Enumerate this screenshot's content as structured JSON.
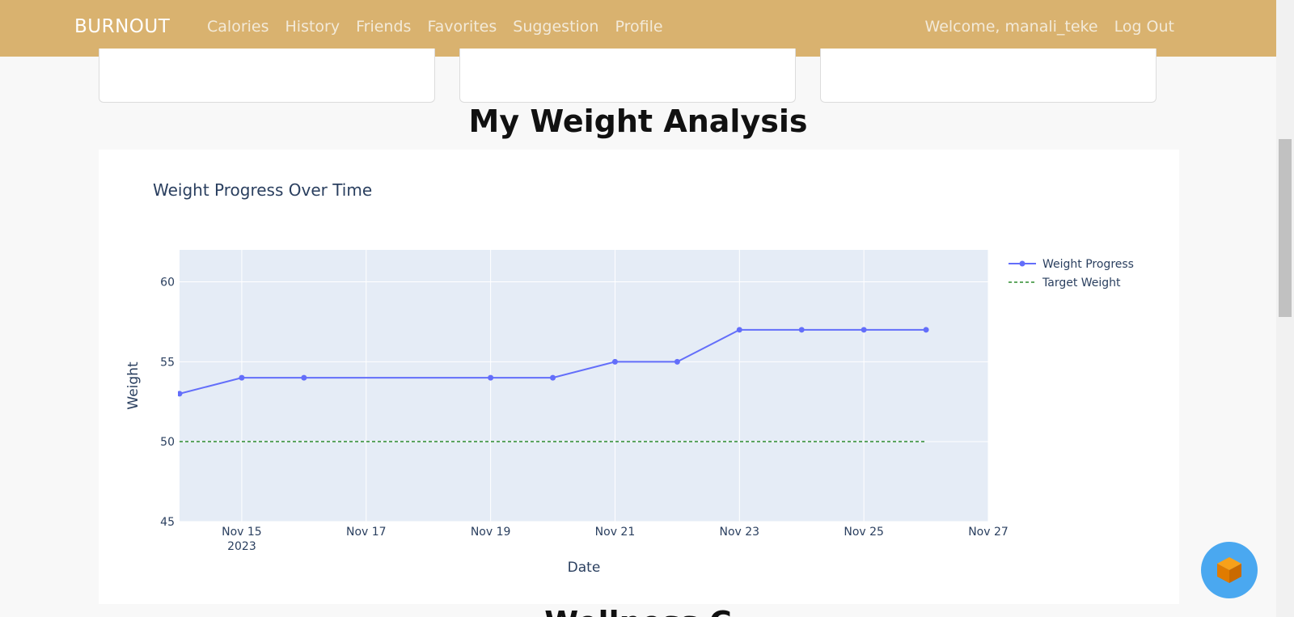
{
  "nav": {
    "brand": "BURNOUT",
    "links": [
      "Calories",
      "History",
      "Friends",
      "Favorites",
      "Suggestion",
      "Profile"
    ],
    "welcome": "Welcome, manali_teke",
    "logout": "Log Out"
  },
  "page": {
    "title": "My Weight Analysis",
    "next_section_title": "Wellness C"
  },
  "colors": {
    "navbar": "#d9b26f",
    "series": "#636efa",
    "target": "#2e8b2e",
    "plot_bg": "#e5ecf6"
  },
  "chart_data": {
    "type": "line",
    "title": "Weight Progress Over Time",
    "xlabel": "Date",
    "ylabel": "Weight",
    "ylim": [
      45,
      62
    ],
    "xlim": [
      "2023-11-14",
      "2023-11-27"
    ],
    "x_ticks": [
      "Nov 15",
      "Nov 17",
      "Nov 19",
      "Nov 21",
      "Nov 23",
      "Nov 25",
      "Nov 27"
    ],
    "x_tick_year": "2023",
    "y_ticks": [
      45,
      50,
      55,
      60
    ],
    "grid": true,
    "legend": "top-right",
    "series": [
      {
        "name": "Weight Progress",
        "style": "lines+markers",
        "x": [
          "2023-11-14",
          "2023-11-15",
          "2023-11-16",
          "2023-11-19",
          "2023-11-20",
          "2023-11-21",
          "2023-11-22",
          "2023-11-23",
          "2023-11-24",
          "2023-11-25",
          "2023-11-26"
        ],
        "y": [
          53,
          54,
          54,
          54,
          54,
          55,
          55,
          57,
          57,
          57,
          57
        ]
      },
      {
        "name": "Target Weight",
        "style": "dashed",
        "x": [
          "2023-11-14",
          "2023-11-26"
        ],
        "y": [
          50,
          50
        ]
      }
    ]
  }
}
